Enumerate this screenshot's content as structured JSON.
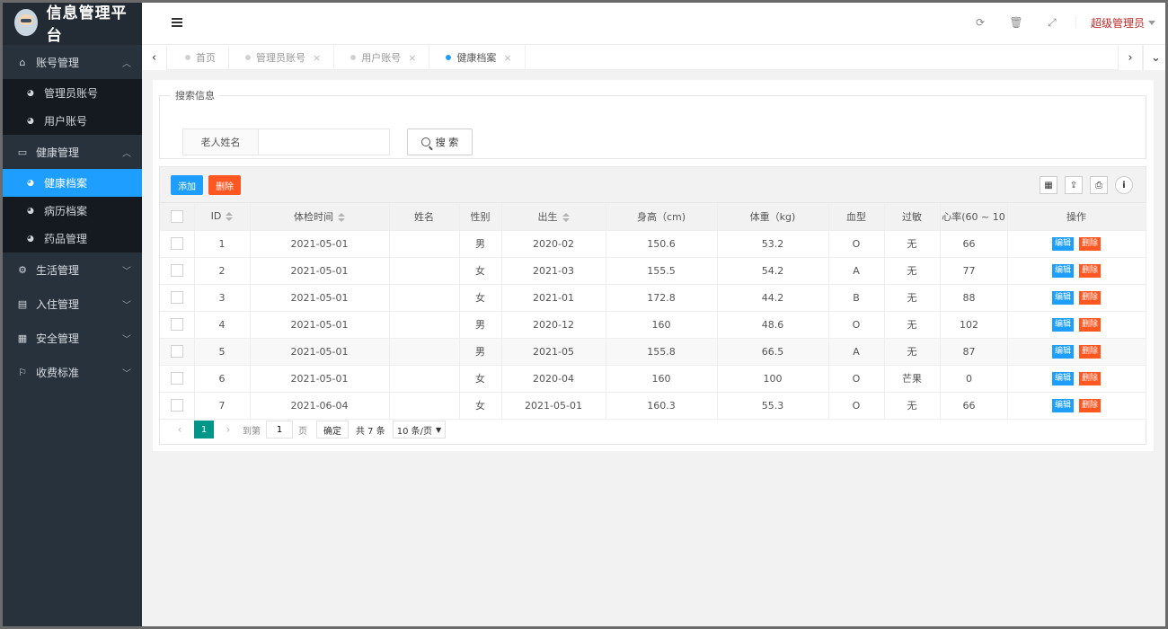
{
  "app": {
    "title": "信息管理平台"
  },
  "sidebar": {
    "groups": [
      {
        "label": "账号管理",
        "icon": "home-icon",
        "expanded": true,
        "items": [
          {
            "label": "管理员账号"
          },
          {
            "label": "用户账号"
          }
        ]
      },
      {
        "label": "健康管理",
        "icon": "window-icon",
        "expanded": true,
        "items": [
          {
            "label": "健康档案",
            "active": true
          },
          {
            "label": "病历档案"
          },
          {
            "label": "药品管理"
          }
        ]
      },
      {
        "label": "生活管理",
        "icon": "gears-icon",
        "expanded": false
      },
      {
        "label": "入住管理",
        "icon": "file-icon",
        "expanded": false
      },
      {
        "label": "安全管理",
        "icon": "calendar-icon",
        "expanded": false
      },
      {
        "label": "收费标准",
        "icon": "flag-icon",
        "expanded": false
      }
    ]
  },
  "header": {
    "user": "超级管理员"
  },
  "tabs": [
    {
      "label": "首页",
      "closable": false
    },
    {
      "label": "管理员账号",
      "closable": true
    },
    {
      "label": "用户账号",
      "closable": true
    },
    {
      "label": "健康档案",
      "closable": true,
      "active": true
    }
  ],
  "search": {
    "legend": "搜索信息",
    "label": "老人姓名",
    "value": "",
    "placeholder": "",
    "button": "搜 索"
  },
  "toolbar": {
    "add": "添加",
    "delete": "删除"
  },
  "table": {
    "columns": [
      "ID",
      "体检时间",
      "姓名",
      "性别",
      "出生",
      "身高（cm)",
      "体重（kg)",
      "血型",
      "过敏",
      "心率(60 ~ 10",
      "操作"
    ],
    "rows": [
      [
        "1",
        "2021-05-01",
        "",
        "男",
        "2020-02",
        "150.6",
        "53.2",
        "O",
        "无",
        "66"
      ],
      [
        "2",
        "2021-05-01",
        "",
        "女",
        "2021-03",
        "155.5",
        "54.2",
        "A",
        "无",
        "77"
      ],
      [
        "3",
        "2021-05-01",
        "",
        "女",
        "2021-01",
        "172.8",
        "44.2",
        "B",
        "无",
        "88"
      ],
      [
        "4",
        "2021-05-01",
        "",
        "男",
        "2020-12",
        "160",
        "48.6",
        "O",
        "无",
        "102"
      ],
      [
        "5",
        "2021-05-01",
        "",
        "男",
        "2021-05",
        "155.8",
        "66.5",
        "A",
        "无",
        "87"
      ],
      [
        "6",
        "2021-05-01",
        "",
        "女",
        "2020-04",
        "160",
        "100",
        "O",
        "芒果",
        "0"
      ],
      [
        "7",
        "2021-06-04",
        "",
        "女",
        "2021-05-01",
        "160.3",
        "55.3",
        "O",
        "无",
        "66"
      ]
    ],
    "row_actions": {
      "edit": "编辑",
      "delete": "删除"
    }
  },
  "pager": {
    "current": "1",
    "goto_prefix": "到第",
    "goto_value": "1",
    "goto_suffix": "页",
    "confirm": "确定",
    "total": "共 7 条",
    "limit": "10 条/页"
  }
}
